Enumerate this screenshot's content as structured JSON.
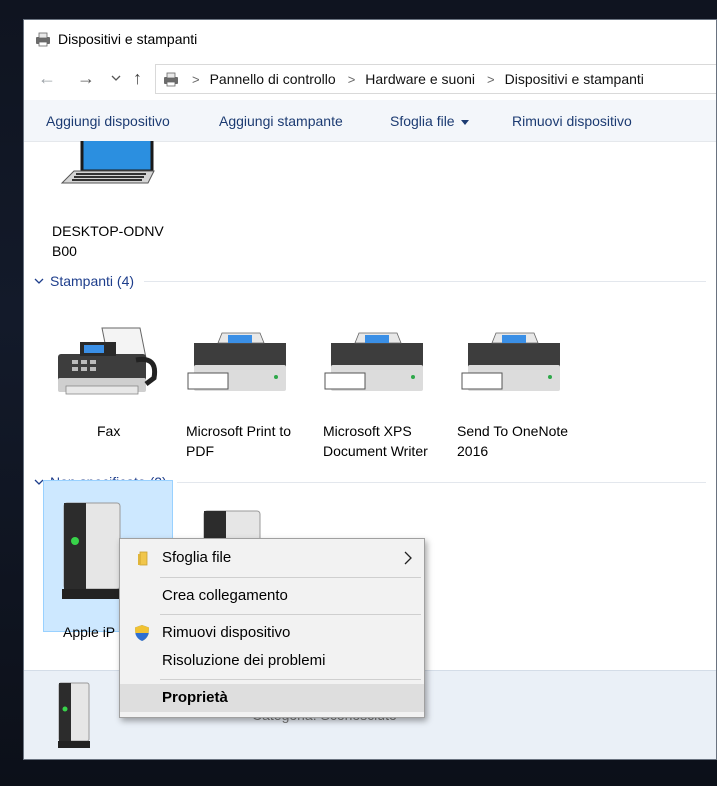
{
  "window": {
    "title": "Dispositivi e stampanti"
  },
  "nav": {
    "back_icon": "arrow-left-icon",
    "forward_icon": "arrow-right-icon",
    "recent_icon": "chevron-down-icon",
    "up_icon": "arrow-up-icon"
  },
  "breadcrumb": [
    "Pannello di controllo",
    "Hardware e suoni",
    "Dispositivi e stampanti"
  ],
  "toolbar": {
    "add_device": "Aggiungi dispositivo",
    "add_printer": "Aggiungi stampante",
    "browse_files": "Sfoglia file",
    "remove_device": "Rimuovi dispositivo"
  },
  "devices": {
    "computer": {
      "name_line1": "DESKTOP-ODNV",
      "name_line2": "B00"
    }
  },
  "printers": {
    "header": "Stampanti (4)",
    "items": [
      {
        "line1": "Fax",
        "line2": ""
      },
      {
        "line1": "Microsoft Print to",
        "line2": "PDF"
      },
      {
        "line1": "Microsoft XPS",
        "line2": "Document Writer"
      },
      {
        "line1": "Send To OneNote",
        "line2": "2016"
      }
    ]
  },
  "unspecified": {
    "header": "Non specificato (2)",
    "selected_label": "Apple iP"
  },
  "details": {
    "status_text": "Categoria: Sconosciuto"
  },
  "context_menu": {
    "browse_files": "Sfoglia file",
    "create_shortcut": "Crea collegamento",
    "remove_device": "Rimuovi dispositivo",
    "troubleshoot": "Risoluzione dei problemi",
    "properties": "Proprietà"
  },
  "colors": {
    "accent_text": "#1c3b72",
    "group_header": "#1e3e8c",
    "selection_bg": "#cde8ff",
    "selection_border": "#99d1ff"
  }
}
